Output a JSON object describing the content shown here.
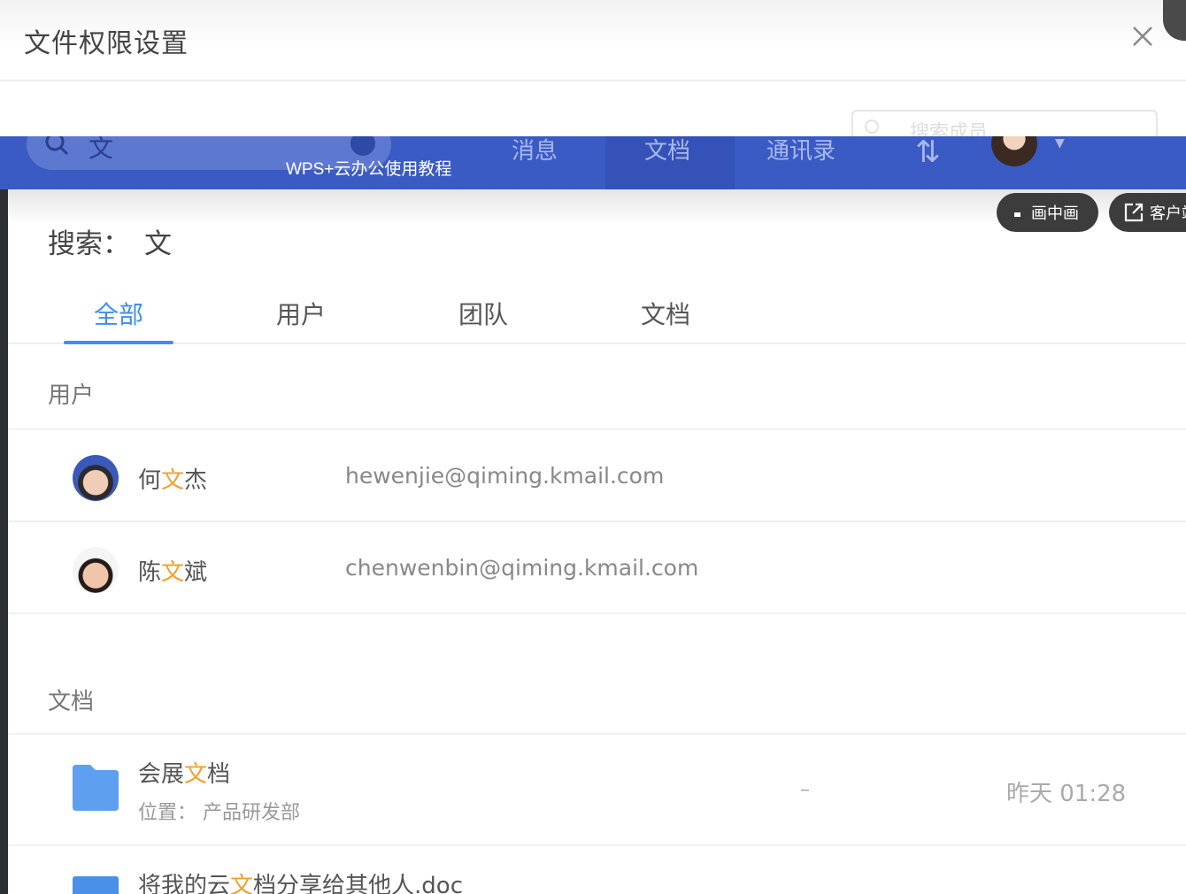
{
  "dialog": {
    "title": "文件权限设置"
  },
  "background_app": {
    "search_query": "文",
    "nav": [
      "消息",
      "文档",
      "通讯录"
    ],
    "member_search_placeholder": "搜索成员"
  },
  "overlay": {
    "caption": "WPS+云办公使用教程",
    "pip_label": "画中画",
    "client_label": "客户端"
  },
  "search": {
    "label": "搜索：",
    "keyword": "文"
  },
  "tabs": [
    "全部",
    "用户",
    "团队",
    "文档"
  ],
  "active_tab": "全部",
  "users_section": {
    "label": "用户",
    "items": [
      {
        "name_pre": "何",
        "name_hl": "文",
        "name_post": "杰",
        "email": "hewenjie@qiming.kmail.com"
      },
      {
        "name_pre": "陈",
        "name_hl": "文",
        "name_post": "斌",
        "email": "chenwenbin@qiming.kmail.com"
      }
    ]
  },
  "docs_section": {
    "label": "文档",
    "items": [
      {
        "title_pre": "会展",
        "title_hl": "文",
        "title_post": "档",
        "location": "位置： 产品研发部",
        "size": "–",
        "time": "昨天 01:28"
      },
      {
        "title_pre": "将我的云",
        "title_hl": "文",
        "title_post": "档分享给其他人.doc"
      }
    ]
  },
  "colors": {
    "accent": "#3e8ef0",
    "highlight": "#f2a02c",
    "appbar": "#3a5bc4"
  }
}
